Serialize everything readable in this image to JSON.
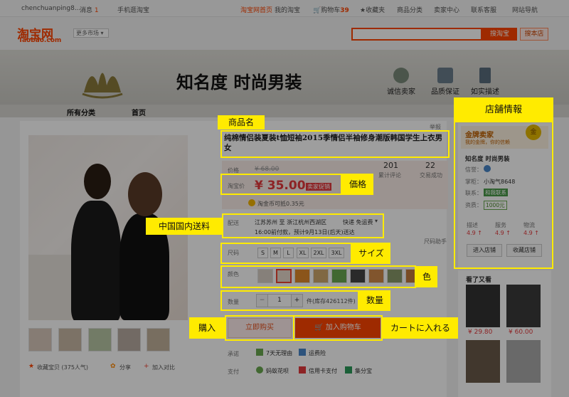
{
  "topbar": {
    "user": "chenchuanping8...",
    "messages_label": "消息",
    "messages_count": "1",
    "mobile": "手机逛淘宝",
    "home": "淘宝网首页",
    "my_taobao": "我的淘宝",
    "cart_label": "购物车",
    "cart_count": "39",
    "favorites": "收藏夹",
    "categories": "商品分类",
    "seller_center": "卖家中心",
    "service": "联系客服",
    "sitemap": "网站导航"
  },
  "header": {
    "logo_main": "淘宝网",
    "logo_sub": "Taobao.com",
    "more_market": "更多市场",
    "search_button": "搜淘宝",
    "search_shop_button": "搜本店"
  },
  "banner": {
    "store_title": "知名度 时尚男装",
    "badges": [
      "诚信卖家",
      "品质保证",
      "如实描述"
    ]
  },
  "nav": {
    "items": [
      "所有分类",
      "首页"
    ]
  },
  "report": "举报",
  "product": {
    "title": "纯棉情侣装夏装t恤短袖2015季情侣半袖修身潮版韩国学生上衣男女",
    "original_price_label": "价格",
    "original_price": "¥ 68.00",
    "price_label": "淘宝价",
    "price": "¥ 35.00",
    "price_tag": "卖家促销",
    "reviews_count": "201",
    "reviews_label": "累计评论",
    "sales_count": "22",
    "sales_label": "交易成功",
    "coin_text": "淘金币可抵0.35元",
    "shipping_label": "配送",
    "shipping_from_to": "江苏苏州 至  浙江杭州西湖区",
    "shipping_type": "快递 免运费",
    "shipping_time": "16:00前付款，预计9月13日(后天)送达",
    "size_helper": "尺码助手",
    "size_label": "尺码",
    "sizes": [
      "S",
      "M",
      "L",
      "XL",
      "2XL",
      "3XL"
    ],
    "color_label": "颜色",
    "qty_label": "数量",
    "qty_minus": "−",
    "qty_value": "1",
    "qty_plus": "+",
    "stock": "件(库存426112件)",
    "buy_now": "立即购买",
    "add_to_cart": "加入购物车",
    "promise_label": "承诺",
    "promises": [
      "7天无理由",
      "运费险"
    ],
    "payment_label": "支付",
    "payments": [
      "蚂蚁花呗",
      "信用卡支付",
      "集分宝"
    ],
    "favorite": "收藏宝贝 (375人气)",
    "share": "分享",
    "compare": "加入对比"
  },
  "shop": {
    "badge": "金牌卖家",
    "badge_sub": "我的金牌，你的信赖",
    "medal": "金",
    "name": "知名度 时尚男装",
    "credit_label": "信誉：",
    "keeper_label": "掌柜：",
    "keeper": "小淘气8648",
    "contact_label": "联系：",
    "contact_status": "和我联系",
    "qual_label": "资质：",
    "deposit": "1000元",
    "ratings": [
      {
        "label": "描述",
        "value": "4.9 ↑"
      },
      {
        "label": "服务",
        "value": "4.9 ↑"
      },
      {
        "label": "物流",
        "value": "4.9 ↑"
      }
    ],
    "enter_shop": "进入店铺",
    "fav_shop": "收藏店铺"
  },
  "also_viewed": {
    "title": "看了又看",
    "prices": [
      "¥ 29.80",
      "¥ 60.00"
    ]
  },
  "annotations": {
    "title": "商品名",
    "shop": "店舗情報",
    "price": "価格",
    "shipping": "中国国内送料",
    "size": "サイズ",
    "color": "色",
    "quantity": "数量",
    "buy": "購入",
    "cart": "カートに入れる"
  },
  "colors": {
    "brand": "#ff4400",
    "price": "#e4393c",
    "annotation": "#ffeb00"
  }
}
